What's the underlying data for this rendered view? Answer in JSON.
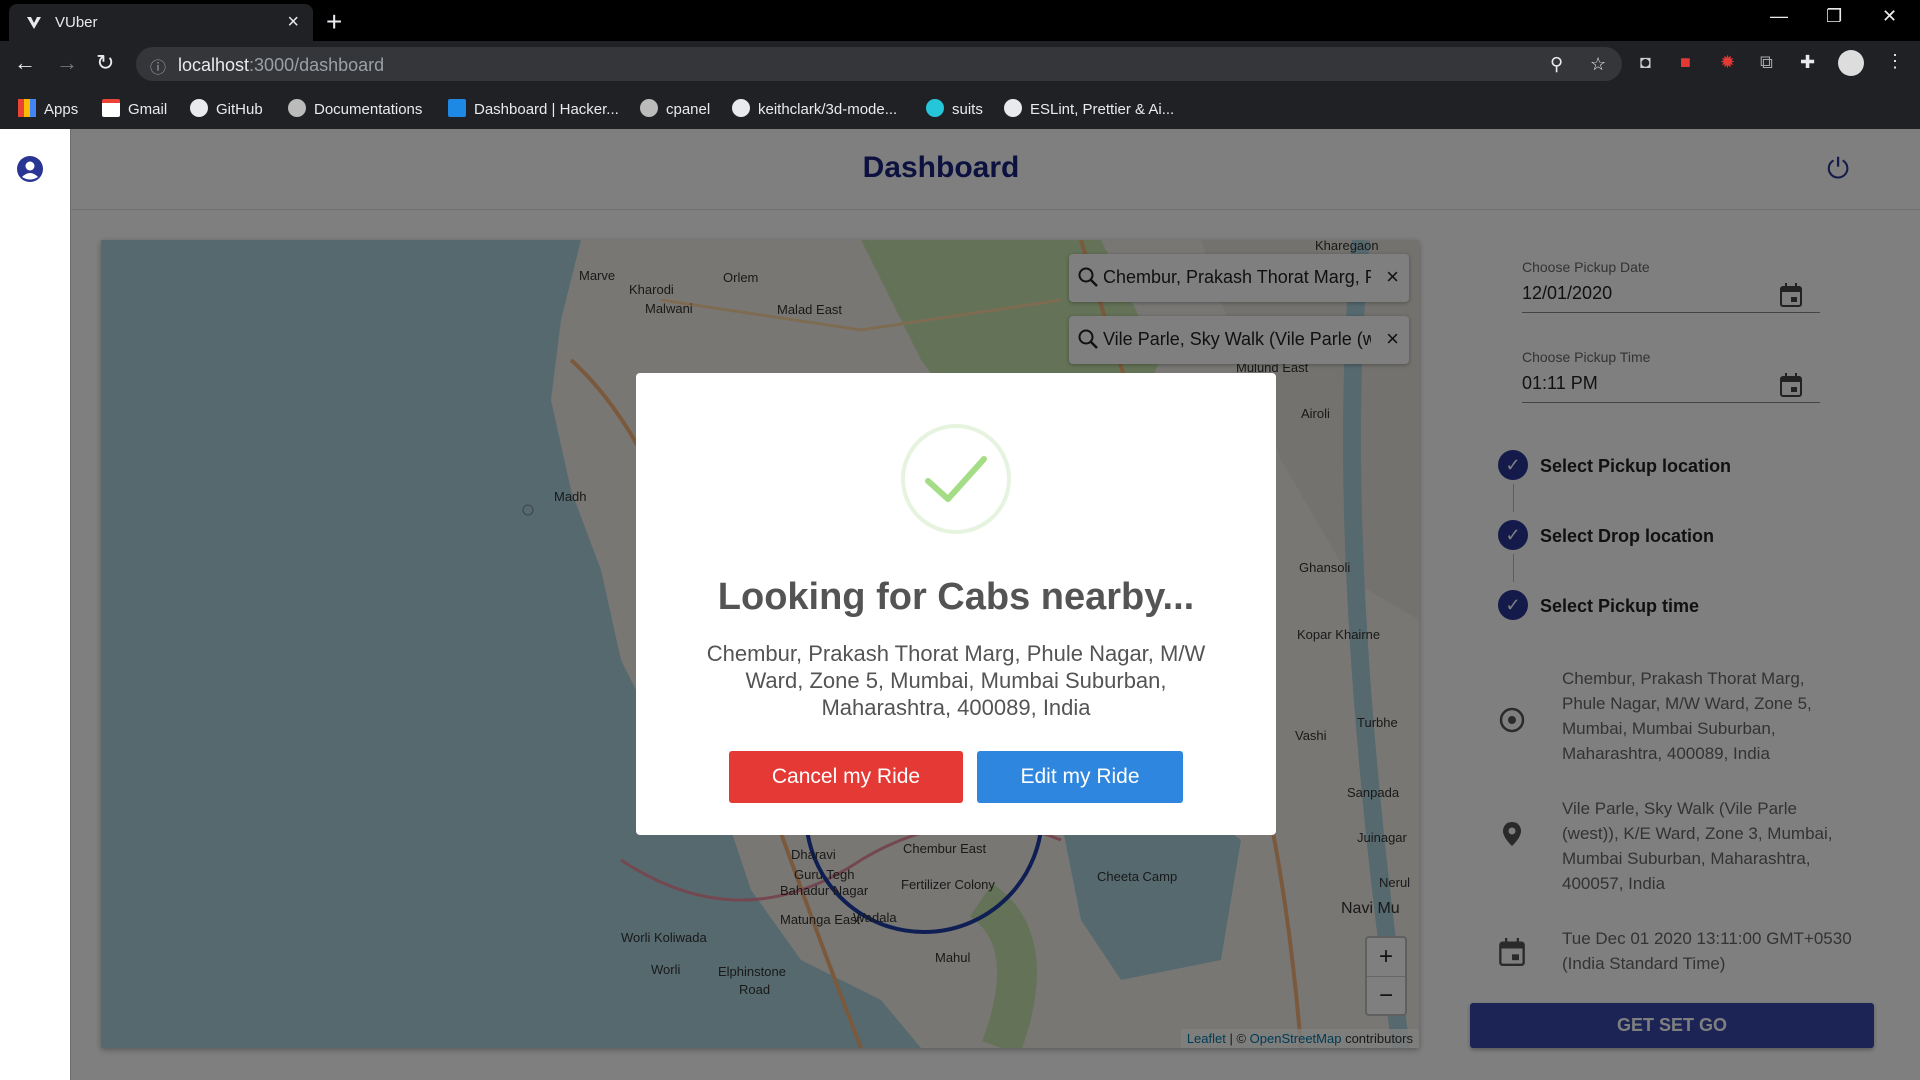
{
  "browser": {
    "tab_title": "VUber",
    "tab_close": "×",
    "new_tab": "+",
    "url_host": "localhost",
    "url_path": ":3000/dashboard",
    "bookmarks": [
      {
        "label": "Apps",
        "icon": "apps-grid-icon"
      },
      {
        "label": "Gmail",
        "icon": "gmail-icon"
      },
      {
        "label": "GitHub",
        "icon": "github-icon"
      },
      {
        "label": "Documentations",
        "icon": "globe-icon"
      },
      {
        "label": "Dashboard | Hacker...",
        "icon": "hackerrank-icon"
      },
      {
        "label": "cpanel",
        "icon": "globe-icon"
      },
      {
        "label": "keithclark/3d-mode...",
        "icon": "github-icon"
      },
      {
        "label": "suits",
        "icon": "suits-icon"
      },
      {
        "label": "ESLint, Prettier & Ai...",
        "icon": "github-icon"
      }
    ]
  },
  "header": {
    "title": "Dashboard"
  },
  "map": {
    "pickup_search": "Chembur, Prakash Thorat Marg, Phule Nagar",
    "drop_search": "Vile Parle, Sky Walk (Vile Parle (west)), K/E Ward",
    "clear_symbol": "×",
    "zoom_in": "+",
    "zoom_out": "−",
    "attribution_leaflet": "Leaflet",
    "attribution_sep": " | © ",
    "attribution_osm": "OpenStreetMap",
    "attribution_contrib": " contributors",
    "places": [
      "Kharegaon",
      "Marve",
      "Kharodi",
      "Orlem",
      "Malwani",
      "Malad East",
      "Airoli",
      "Madh",
      "Ghansoli",
      "Kopar Khairne",
      "Vashi",
      "Turbhe",
      "Sanpada",
      "Juinagar",
      "Nerul",
      "Navi Mu",
      "Dharavi",
      "Chembur East",
      "Guru Tegh",
      "Bahadur Nagar",
      "Fertilizer Colony",
      "Cheeta Camp",
      "Matunga East",
      "Wadala",
      "Worli Koliwada",
      "Worli",
      "Elphinstone",
      "Road",
      "Mahul",
      "Mulund East"
    ]
  },
  "form": {
    "pickup_date_label": "Choose Pickup Date",
    "pickup_date_value": "12/01/2020",
    "pickup_time_label": "Choose Pickup Time",
    "pickup_time_value": "01:11 PM",
    "check_symbol": "✓"
  },
  "steps": [
    {
      "label": "Select Pickup location"
    },
    {
      "label": "Select Drop location"
    },
    {
      "label": "Select Pickup time"
    }
  ],
  "summary": {
    "pickup": "Chembur, Prakash Thorat Marg, Phule Nagar, M/W Ward, Zone 5, Mumbai, Mumbai Suburban, Maharashtra, 400089, India",
    "drop": "Vile Parle, Sky Walk (Vile Parle (west)), K/E Ward, Zone 3, Mumbai, Mumbai Suburban, Maharashtra, 400057, India",
    "datetime": "Tue Dec 01 2020 13:11:00 GMT+0530 (India Standard Time)"
  },
  "actions": {
    "go_label": "GET SET GO"
  },
  "modal": {
    "title": "Looking for Cabs nearby...",
    "address": "Chembur, Prakash Thorat Marg, Phule Nagar, M/W Ward, Zone 5, Mumbai, Mumbai Suburban, Maharashtra, 400089, India",
    "cancel_label": "Cancel my Ride",
    "edit_label": "Edit my Ride"
  },
  "colors": {
    "brand": "#283593",
    "cancel": "#e53935",
    "edit": "#2e86de",
    "success": "#a5dc86"
  }
}
